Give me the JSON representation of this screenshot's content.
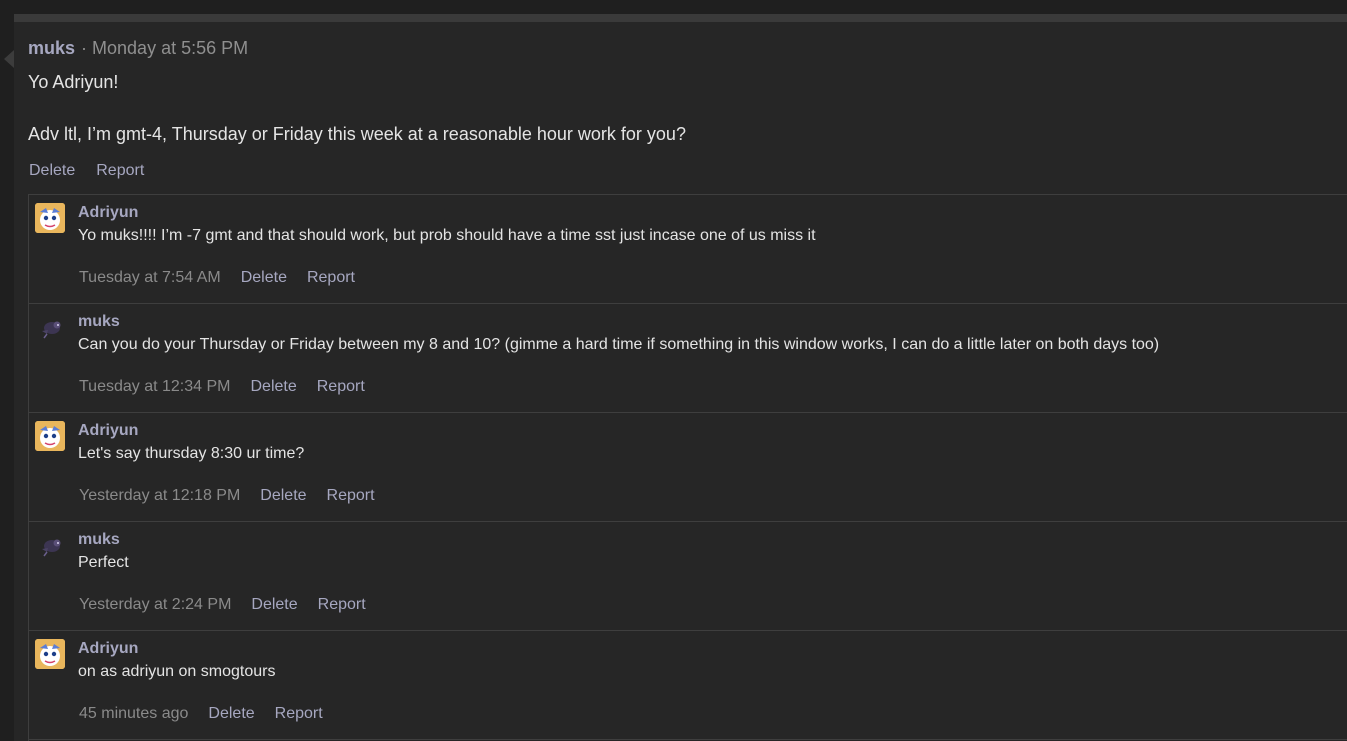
{
  "post": {
    "author": "muks",
    "separator": "·",
    "timestamp": "Monday at 5:56 PM",
    "lines": [
      "Yo Adriyun!",
      "Adv ltl, I’m gmt-4, Thursday or Friday this week at a reasonable hour work for you?"
    ],
    "actions": {
      "delete": "Delete",
      "report": "Report"
    }
  },
  "replies": [
    {
      "author": "Adriyun",
      "avatar": "adriyun-avatar",
      "text": "Yo muks!!!! I’m -7 gmt and that should work, but prob should have a time sst just incase one of us miss it",
      "time": "Tuesday at 7:54 AM",
      "delete": "Delete",
      "report": "Report"
    },
    {
      "author": "muks",
      "avatar": "muks-avatar",
      "text": "Can you do your Thursday or Friday between my 8 and 10? (gimme a hard time if something in this window works, I can do a little later on both days too)",
      "time": "Tuesday at 12:34 PM",
      "delete": "Delete",
      "report": "Report"
    },
    {
      "author": "Adriyun",
      "avatar": "adriyun-avatar",
      "text": "Let's say thursday 8:30 ur time?",
      "time": "Yesterday at 12:18 PM",
      "delete": "Delete",
      "report": "Report"
    },
    {
      "author": "muks",
      "avatar": "muks-avatar",
      "text": "Perfect",
      "time": "Yesterday at 2:24 PM",
      "delete": "Delete",
      "report": "Report"
    },
    {
      "author": "Adriyun",
      "avatar": "adriyun-avatar",
      "text": "on as adriyun on smogtours",
      "time": "45 minutes ago",
      "delete": "Delete",
      "report": "Report"
    }
  ],
  "colors": {
    "background": "#262626",
    "username": "#a6a7c0",
    "text": "#e4e4e4",
    "muted": "#8f8f8f",
    "border": "#3e3e3e"
  }
}
